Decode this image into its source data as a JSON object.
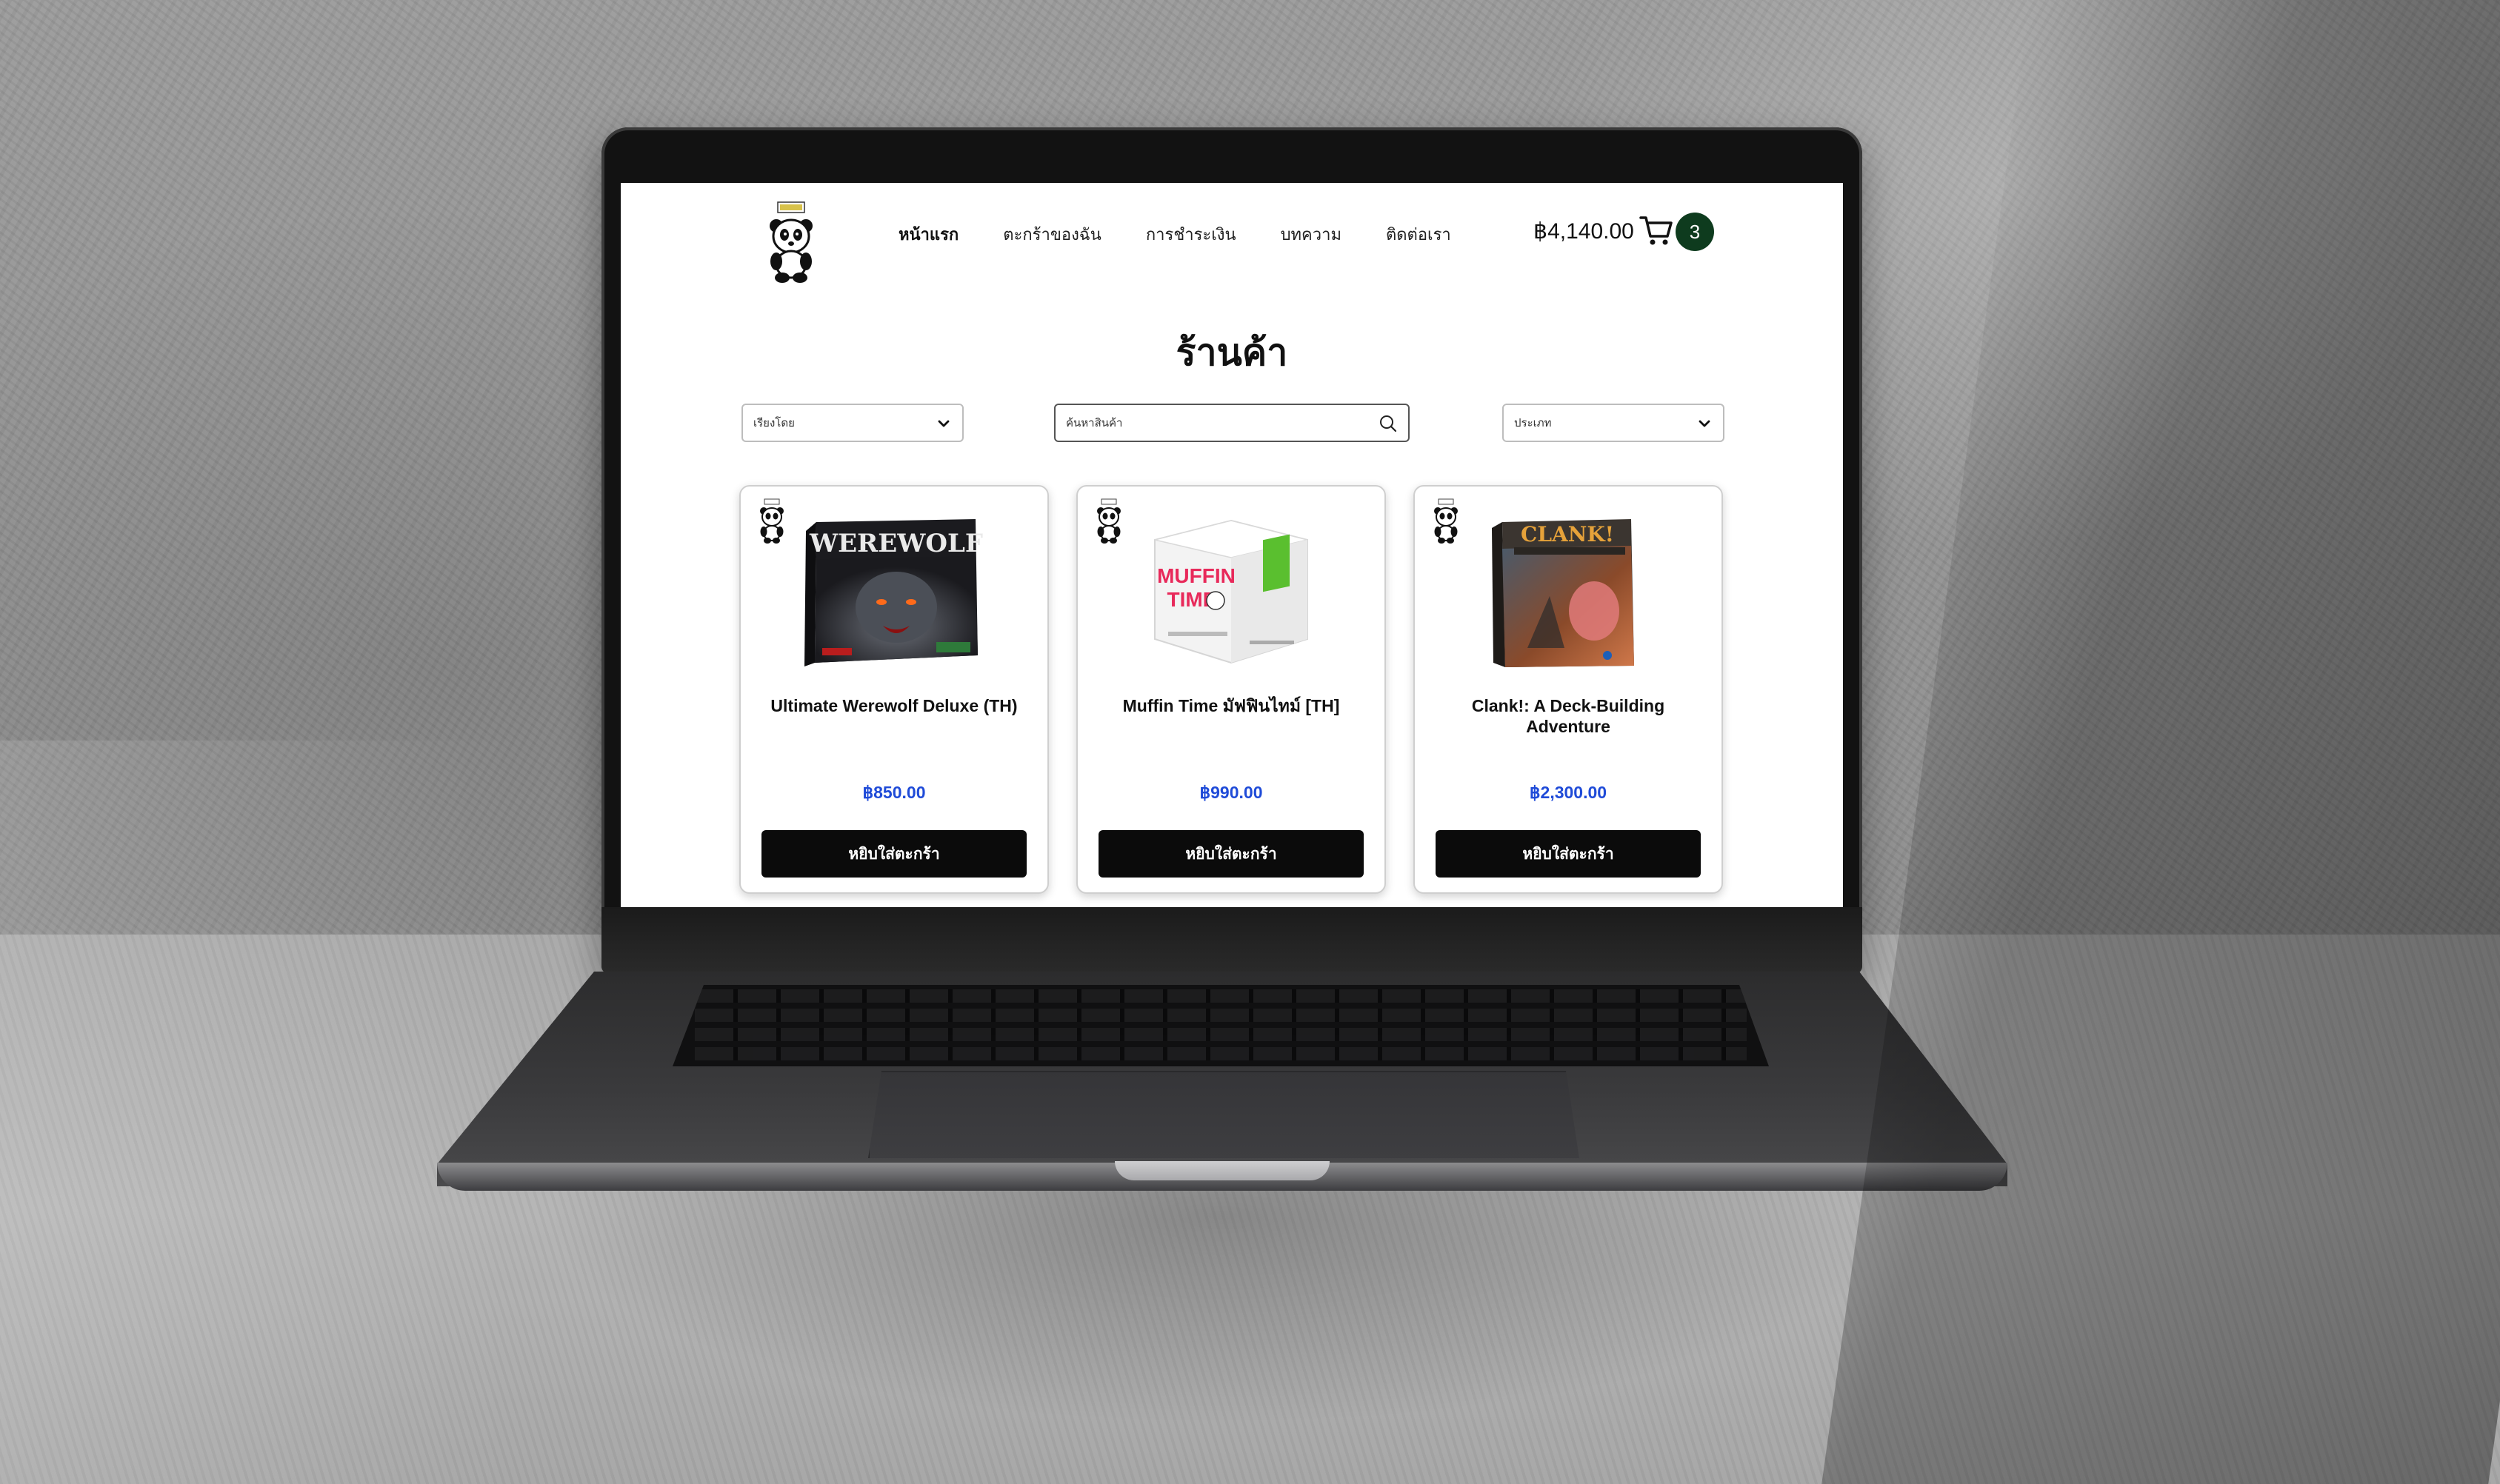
{
  "nav": {
    "items": [
      {
        "label": "หน้าแรก",
        "active": true
      },
      {
        "label": "ตะกร้าของฉัน",
        "active": false
      },
      {
        "label": "การชำระเงิน",
        "active": false
      },
      {
        "label": "บทความ",
        "active": false
      },
      {
        "label": "ติดต่อเรา",
        "active": false
      }
    ],
    "cart_total": "฿4,140.00",
    "cart_count": "3",
    "badge_color": "#0e3b1e"
  },
  "page": {
    "title": "ร้านค้า"
  },
  "filters": {
    "sort_label": "เรียงโดย",
    "search_placeholder": "ค้นหาสินค้า",
    "category_label": "ประเภท"
  },
  "products": [
    {
      "name": "Ultimate Werewolf Deluxe (TH)",
      "price": "฿850.00",
      "button": "หยิบใส่ตะกร้า",
      "box_text": "WEREWOLF"
    },
    {
      "name": "Muffin Time มัฟฟินไทม์ [TH]",
      "price": "฿990.00",
      "button": "หยิบใส่ตะกร้า",
      "box_text": "MUFFIN TIME"
    },
    {
      "name": "Clank!: A Deck-Building Adventure",
      "price": "฿2,300.00",
      "button": "หยิบใส่ตะกร้า",
      "box_text": "CLANK!"
    }
  ],
  "colors": {
    "price": "#1f4bd8",
    "button_bg": "#0b0b0b"
  }
}
